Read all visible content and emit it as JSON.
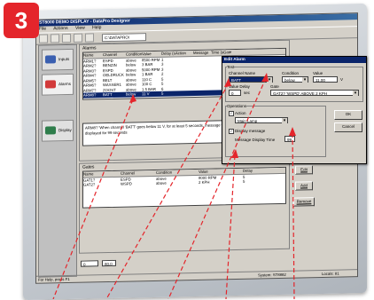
{
  "badge": "3",
  "window": {
    "title": "ST8000 DEMO DISPLAY - DataPro Designer",
    "menu": [
      "File",
      "Actions",
      "View",
      "Help"
    ],
    "path": "C:\\DATAPRO\\"
  },
  "nav": [
    {
      "label": "Inputs",
      "color": "#3a5fb0"
    },
    {
      "label": "Alarms",
      "color": "#d23a3a"
    },
    {
      "label": "Display",
      "color": "#2e7d4b"
    }
  ],
  "alarms": {
    "title": "Alarms",
    "columns": [
      "Name",
      "Channel",
      "Condition",
      "Value",
      "Delay (sec)",
      "Action",
      "Message",
      "Time (s)",
      "Gate"
    ],
    "rows": [
      [
        "ARM1?",
        "ESPD",
        "above",
        "8500 RPM",
        "1"
      ],
      [
        "ARM2?",
        "BENZIN",
        "below",
        "3 BAR",
        "3"
      ],
      [
        "ARM3?",
        "ESPD",
        "above",
        "5000 RPM",
        "3"
      ],
      [
        "ARM4?",
        "OELDRUCK",
        "below",
        "1 BAR",
        "2"
      ],
      [
        "ARM5?",
        "BELT",
        "above",
        "110 C",
        "5"
      ],
      [
        "ARM6?",
        "WASSER1",
        "above",
        "100 C",
        "5"
      ],
      [
        "ARM7?",
        "ZOOST",
        "above",
        "1.5 BAR",
        "6"
      ],
      [
        "ARM8?",
        "BATT",
        "below",
        "11 V",
        "5"
      ]
    ],
    "message": "ARM8? 'When channel 'BATT' goes below 11 V, for at least 5 seconds, message will be displayed for 99 seconds",
    "buttons": [
      "Edit",
      "Add",
      "Remove"
    ]
  },
  "gates": {
    "title": "Gates",
    "columns": [
      "Name",
      "Channel",
      "Condition",
      "Value",
      "Delay"
    ],
    "rows": [
      [
        "GAT1?",
        "ESPD",
        "above",
        "8000 RPM",
        "5"
      ],
      [
        "GAT2?",
        "WSPD",
        "above",
        "2 KPH",
        "5"
      ]
    ],
    "buttons": [
      "Edit",
      "Add",
      "Remove"
    ],
    "footer_value": "0",
    "footer_unit": "80.0"
  },
  "status": {
    "left": "For Help, press F1",
    "middle": "System: ST8882",
    "right": "Locals: 81"
  },
  "dialog": {
    "title": "Edit Alarm",
    "test_group": "Test",
    "channel_label": "Channel Name",
    "channel_value": "BATT",
    "condition_label": "Condition",
    "condition_value": "below",
    "value_label": "Value",
    "value_value": "11.00",
    "value_unit": "V",
    "delay_label": "Value Delay",
    "delay_value": "0",
    "delay_unit": "sec",
    "gate_label": "Gate",
    "gate_value": "GAT2? 'WSPD' ABOVE 2 KPH",
    "operations_label": "Operations",
    "action_check": "Action",
    "action_value": "Main Lamp",
    "display_check": "Display message",
    "message_time_label": "Message Display Time",
    "message_time_value": "99",
    "ok": "OK",
    "cancel": "Cancel"
  }
}
